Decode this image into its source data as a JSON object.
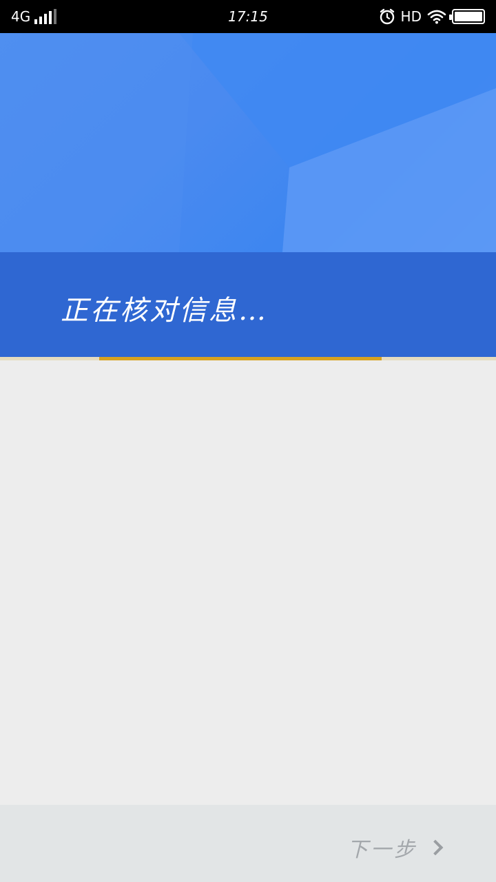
{
  "status_bar": {
    "network": "4G",
    "time": "17:15",
    "hd": "HD",
    "alarm_icon": "alarm-icon",
    "wifi_icon": "wifi-icon",
    "battery_icon": "battery-icon",
    "signal_icon": "signal-icon"
  },
  "banner": {
    "message": "正在核对信息…"
  },
  "progress": {
    "fraction": 0.57
  },
  "footer": {
    "next_label": "下一步",
    "next_icon": "chevron-right-icon"
  },
  "colors": {
    "banner": "#2f67d2",
    "hero": "#4a8af0",
    "progress": "#d8a21f",
    "background": "#ededed",
    "footer": "#e2e5e6"
  }
}
